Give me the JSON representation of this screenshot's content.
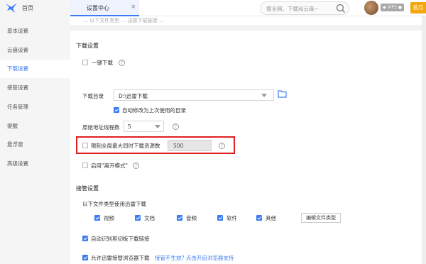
{
  "header": {
    "home_label": "首页",
    "tab_label": "设置中心",
    "tab_close": "×",
    "search_placeholder": "搜全网、下载和云盘~",
    "vip_badge": "◆ VIP3 ●",
    "gold_label": "首月"
  },
  "sidebar": {
    "items": [
      {
        "label": "基本设置"
      },
      {
        "label": "云盘设置"
      },
      {
        "label": "下载设置",
        "active": true
      },
      {
        "label": "接管设置"
      },
      {
        "label": "任务管理"
      },
      {
        "label": "提醒"
      },
      {
        "label": "悬浮窗"
      },
      {
        "label": "高级设置"
      }
    ]
  },
  "download": {
    "partial_text": "… 以下文件类型 … 迅雷下载链接 …",
    "title": "下载设置",
    "one_click_label": "一键下载",
    "dir_label": "下载目录",
    "dir_value": "D:\\迅雷下载",
    "auto_modify_label": "自动修改为上次使用的目录",
    "threads_label": "原始地址线程数",
    "threads_value": "5",
    "limit_label": "限制全局最大同时下载资源数",
    "limit_value": "500",
    "away_mode_label": "启用\"离开模式\""
  },
  "takeover": {
    "title": "接管设置",
    "desc": "以下文件类型使用迅雷下载",
    "types": [
      {
        "label": "视频",
        "checked": true
      },
      {
        "label": "文档",
        "checked": true
      },
      {
        "label": "音频",
        "checked": true
      },
      {
        "label": "软件",
        "checked": true
      },
      {
        "label": "其他",
        "checked": true
      }
    ],
    "edit_types_label": "编辑文件类型",
    "clipboard_label": "自动识别剪切板下载链接",
    "browser_label": "允许迅雷接替浏览器下载",
    "not_working_link": "接管不生效? 点击开启浏览器支持"
  },
  "colors": {
    "accent": "#3b7cf6",
    "highlight": "#e02020",
    "gold": "#f4a60d"
  }
}
